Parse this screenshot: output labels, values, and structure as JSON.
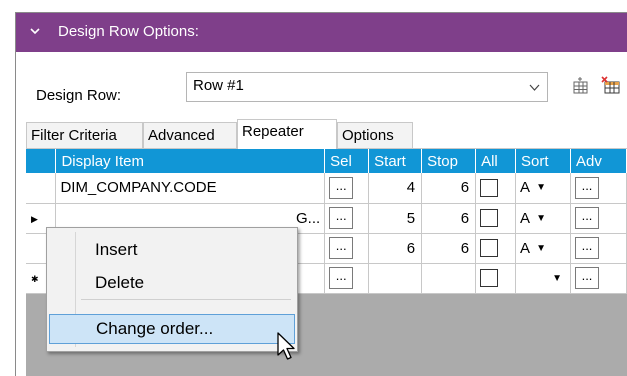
{
  "header": {
    "title": "Design Row Options:"
  },
  "design_row": {
    "label": "Design Row:",
    "value": "Row #1"
  },
  "tabs": [
    {
      "label": "Filter Criteria",
      "active": false
    },
    {
      "label": "Advanced",
      "active": false
    },
    {
      "label": "Repeater",
      "active": true
    },
    {
      "label": "Options",
      "active": false
    }
  ],
  "grid": {
    "columns": [
      "Display Item",
      "Sel",
      "Start",
      "Stop",
      "All",
      "Sort",
      "Adv"
    ],
    "rows": [
      {
        "display_item": "DIM_COMPANY.CODE",
        "sel": "...",
        "start": "4",
        "stop": "6",
        "sort": "A",
        "adv": "..."
      },
      {
        "display_item": "G...",
        "sel": "...",
        "start": "5",
        "stop": "6",
        "sort": "A",
        "adv": "..."
      },
      {
        "display_item": "",
        "sel": "...",
        "start": "6",
        "stop": "6",
        "sort": "A",
        "adv": "..."
      },
      {
        "display_item": "",
        "sel": "...",
        "start": "",
        "stop": "",
        "sort": "",
        "adv": "..."
      }
    ]
  },
  "context_menu": {
    "items": [
      "Insert",
      "Delete",
      "Change order..."
    ],
    "highlighted": "Change order..."
  },
  "colors": {
    "header_bg": "#7f3f8a",
    "grid_header_bg": "#1196d6",
    "menu_highlight": "#cde4f7"
  },
  "icons": [
    "chevron-down-icon",
    "dropdown-arrow-icon",
    "grid-settings-icon",
    "grid-delete-icon",
    "row-pointer-icon",
    "new-row-icon",
    "mouse-cursor-icon"
  ]
}
